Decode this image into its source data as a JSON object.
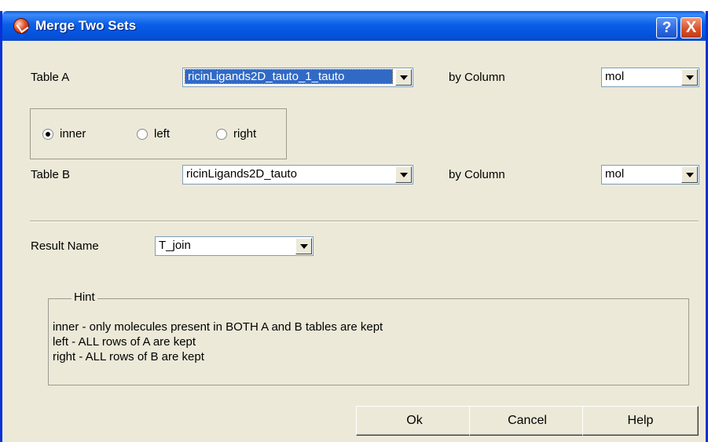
{
  "window": {
    "title": "Merge Two Sets",
    "help_label": "?",
    "close_label": "X"
  },
  "table_a": {
    "label": "Table A",
    "value": "ricinLigands2D_tauto_1_tauto",
    "by_column_label": "by Column",
    "column_value": "mol"
  },
  "join_type": {
    "options": [
      {
        "label": "inner",
        "checked": true
      },
      {
        "label": "left",
        "checked": false
      },
      {
        "label": "right",
        "checked": false
      }
    ]
  },
  "table_b": {
    "label": "Table B",
    "value": "ricinLigands2D_tauto",
    "by_column_label": "by Column",
    "column_value": "mol"
  },
  "result": {
    "label": "Result Name",
    "value": "T_join"
  },
  "hint": {
    "title": "Hint",
    "lines": [
      "inner - only molecules present in BOTH A and B tables are kept",
      "left - ALL rows of A are kept",
      "right - ALL rows of B are kept"
    ]
  },
  "buttons": {
    "ok": "Ok",
    "cancel": "Cancel",
    "help": "Help"
  }
}
